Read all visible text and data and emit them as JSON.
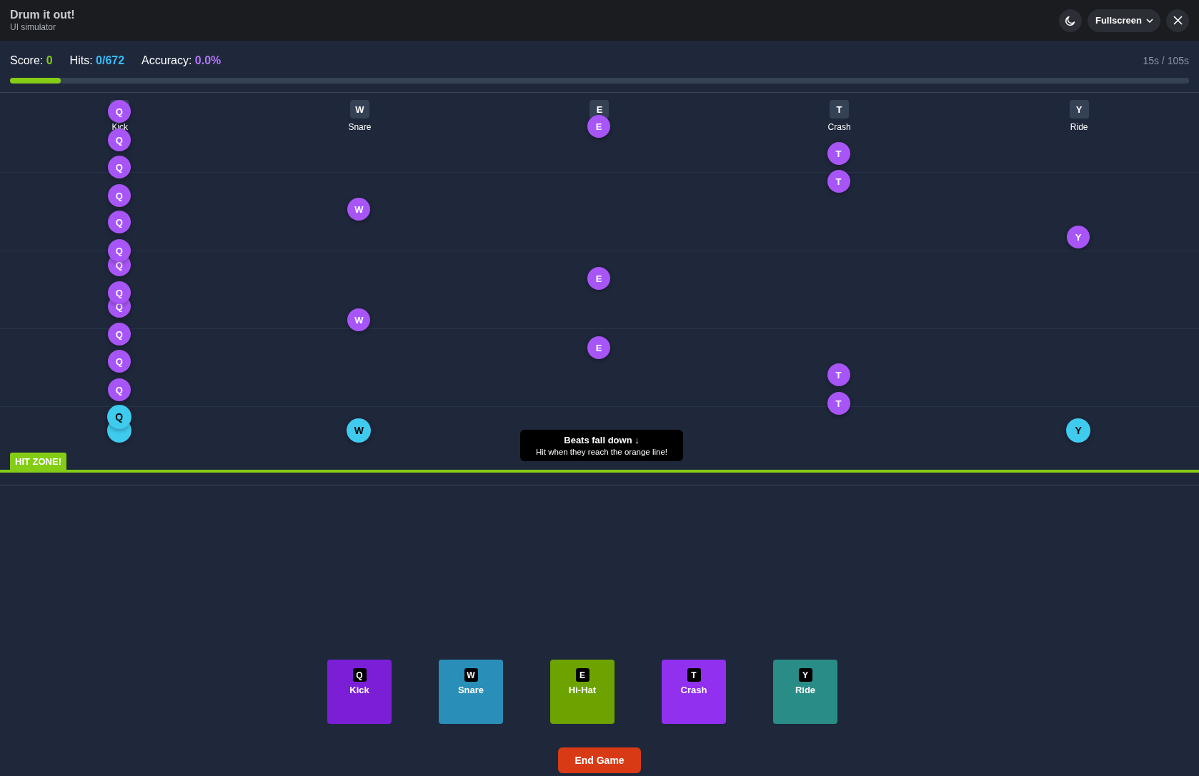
{
  "window": {
    "title": "Drum it out!",
    "subtitle": "UI simulator",
    "buttons": [
      {
        "kind": "theme"
      },
      {
        "kind": "menu",
        "label": "Fullscreen"
      },
      {
        "kind": "close"
      }
    ]
  },
  "stats": {
    "score_label": "Score:",
    "score": "0",
    "hits_label": "Hits:",
    "hits": "0/672",
    "accuracy_label": "Accuracy:",
    "accuracy": "0.0%",
    "time": "15s / 105s",
    "progress": {
      "level": 0.043
    }
  },
  "lanes": [
    {
      "name": "Kick",
      "notes": [
        {
          "letter": "Q",
          "in_hit_zone": false
        },
        {
          "letter": "Q",
          "in_hit_zone": false
        },
        {
          "letter": "Q",
          "in_hit_zone": false
        },
        {
          "letter": "Q",
          "in_hit_zone": false
        },
        {
          "letter": "Q",
          "in_hit_zone": false
        },
        {
          "letter": "Q",
          "in_hit_zone": false
        },
        {
          "letter": "Q",
          "in_hit_zone": false
        },
        {
          "letter": "Q",
          "in_hit_zone": false
        },
        {
          "letter": "Q",
          "in_hit_zone": false
        },
        {
          "letter": "Q",
          "in_hit_zone": false
        },
        {
          "letter": "Q",
          "in_hit_zone": false
        },
        {
          "letter": "Q",
          "in_hit_zone": false
        },
        {
          "letter": "Q",
          "in_hit_zone": true
        },
        {
          "in_hit_zone": true
        }
      ]
    },
    {
      "key": "W",
      "name": "Snare",
      "notes": [
        {
          "letter": "W",
          "in_hit_zone": false
        },
        {
          "letter": "W",
          "in_hit_zone": false
        },
        {
          "letter": "W",
          "in_hit_zone": true
        }
      ]
    },
    {
      "key": "E",
      "notes": [
        {
          "letter": "E",
          "in_hit_zone": false
        },
        {
          "letter": "E",
          "in_hit_zone": false
        },
        {
          "letter": "E",
          "in_hit_zone": false
        }
      ]
    },
    {
      "key": "T",
      "name": "Crash",
      "notes": [
        {
          "letter": "T",
          "in_hit_zone": false
        },
        {
          "letter": "T",
          "in_hit_zone": false
        },
        {
          "letter": "T",
          "in_hit_zone": false
        },
        {
          "letter": "T",
          "in_hit_zone": false
        }
      ]
    },
    {
      "key": "Y",
      "name": "Ride",
      "notes": [
        {
          "letter": "Y",
          "in_hit_zone": false
        },
        {
          "letter": "Y",
          "in_hit_zone": true
        }
      ]
    }
  ],
  "hit_zone": {
    "label": "HIT ZONE!"
  },
  "hint": {
    "title": "Beats fall down ↓",
    "text": "Hit when they reach the orange line!"
  },
  "pads": [
    {
      "key": "Q",
      "name": "Kick",
      "color": "#7a1fd6"
    },
    {
      "key": "W",
      "name": "Snare",
      "color": "#2a8fb8"
    },
    {
      "key": "E",
      "name": "Hi-Hat",
      "color": "#6ca300"
    },
    {
      "key": "T",
      "name": "Crash",
      "color": "#9230f0"
    },
    {
      "key": "Y",
      "name": "Ride",
      "color": "#2a8c86"
    }
  ],
  "end_button": "End Game"
}
